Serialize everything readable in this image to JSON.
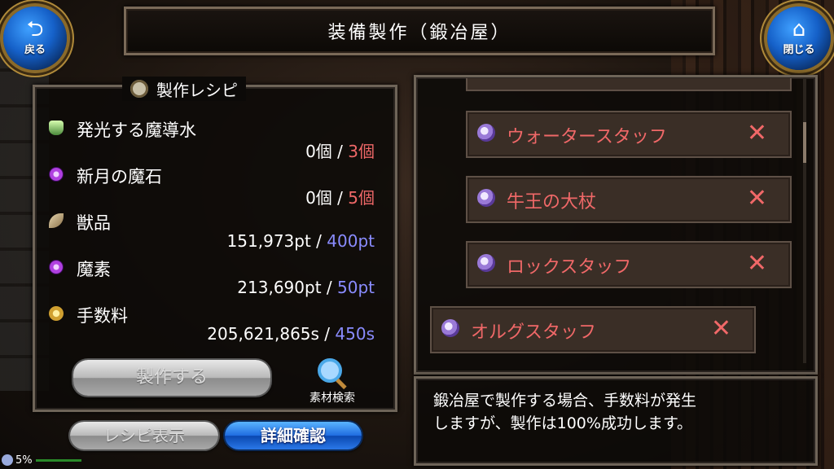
{
  "header": {
    "title": "装備製作（鍛冶屋）",
    "back_label": "戻る",
    "close_label": "閉じる"
  },
  "recipe": {
    "heading": "製作レシピ",
    "materials": [
      {
        "name": "発光する魔導水",
        "have": "0個",
        "sep": " / ",
        "need": "3個",
        "need_color": "red",
        "icon": "potion-flask-icon"
      },
      {
        "name": "新月の魔石",
        "have": "0個",
        "sep": " / ",
        "need": "5個",
        "need_color": "red",
        "icon": "purple-orb-icon"
      },
      {
        "name": "獣品",
        "have": "151,973pt",
        "sep": " / ",
        "need": "400pt",
        "need_color": "blue",
        "icon": "claw-icon"
      },
      {
        "name": "魔素",
        "have": "213,690pt",
        "sep": " / ",
        "need": "50pt",
        "need_color": "blue",
        "icon": "purple-orb-icon"
      },
      {
        "name": "手数料",
        "have": "205,621,865s",
        "sep": " / ",
        "need": "450s",
        "need_color": "blue",
        "icon": "coins-icon"
      }
    ],
    "craft_label": "製作する",
    "search_label": "素材検索",
    "recipe_view_label": "レシピ表示",
    "detail_label": "詳細確認"
  },
  "list": {
    "items": [
      {
        "name": "ウォータースタッフ",
        "mark": "✕"
      },
      {
        "name": "牛王の大杖",
        "mark": "✕"
      },
      {
        "name": "ロックスタッフ",
        "mark": "✕"
      },
      {
        "name": "オルグスタッフ",
        "mark": "✕"
      }
    ]
  },
  "note": {
    "line1": "鍛冶屋で製作する場合、手数料が発生",
    "line2": "しますが、製作は100%成功します。"
  },
  "status": {
    "battery": "5%"
  },
  "colors": {
    "need_red": "#f06868",
    "need_blue": "#8a8cff",
    "accent_blue": "#1f6ce0"
  }
}
